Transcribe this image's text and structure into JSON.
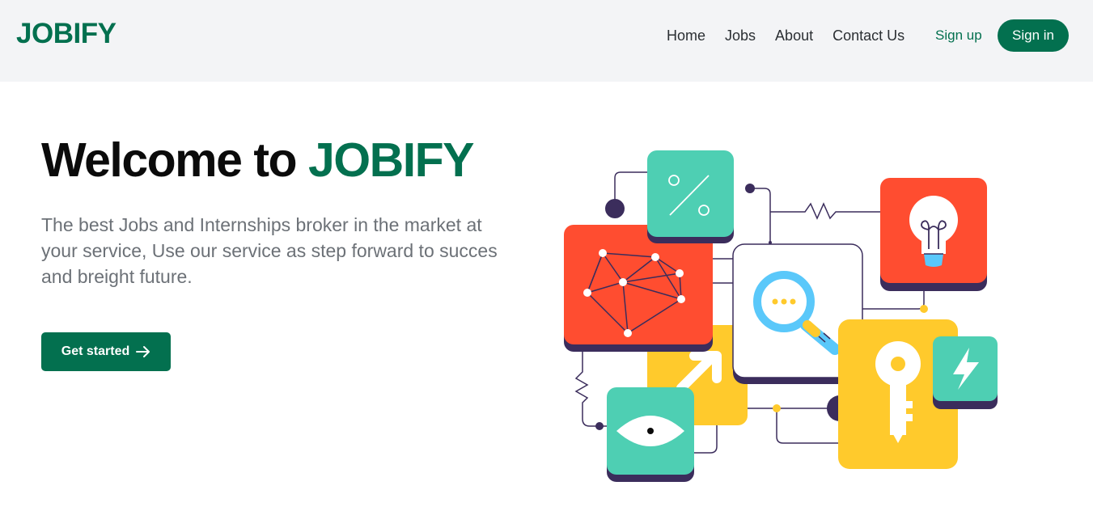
{
  "brand": {
    "name": "JOBIFY",
    "color": "#03704f"
  },
  "nav": {
    "items": [
      {
        "label": "Home"
      },
      {
        "label": "Jobs"
      },
      {
        "label": "About"
      },
      {
        "label": "Contact Us"
      }
    ],
    "signup_label": "Sign up",
    "signin_label": "Sign in"
  },
  "hero": {
    "title_prefix": "Welcome to ",
    "title_accent": "JOBIFY",
    "subtitle": "The best Jobs and Internships broker in the market at your service, Use our service as step forward to succes and breight future.",
    "cta_label": "Get started",
    "cta_icon": "arrow-right-icon"
  },
  "illustration": {
    "icons": [
      "percent-icon",
      "network-icon",
      "lightbulb-icon",
      "magnifier-icon",
      "arrow-up-right-icon",
      "key-icon",
      "lightning-icon",
      "eye-icon"
    ],
    "colors": {
      "teal": "#4ecfb3",
      "red": "#ff4d30",
      "yellow": "#ffca2c",
      "navy": "#3b2d5c",
      "lightblue": "#5ac8fa"
    }
  }
}
